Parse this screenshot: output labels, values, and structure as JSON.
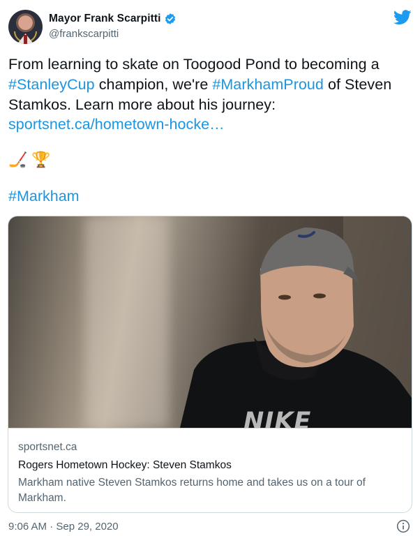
{
  "author": {
    "display_name": "Mayor Frank Scarpitti",
    "handle": "@frankscarpitti",
    "verified": true
  },
  "tweet": {
    "part1": "From learning to skate on Toogood Pond to becoming a ",
    "hashtag1": "#StanleyCup",
    "part2": " champion, we're ",
    "hashtag2": "#MarkhamProud",
    "part3": " of Steven Stamkos. Learn more about his journey: ",
    "link": "sportsnet.ca/hometown-hocke…",
    "emoji1": "🏒",
    "emoji2": "🏆",
    "hashtag3": "#Markham"
  },
  "card": {
    "domain": "sportsnet.ca",
    "title": "Rogers Hometown Hockey: Steven Stamkos",
    "description": "Markham native Steven Stamkos returns home and takes us on a tour of Markham.",
    "image_text": "NIKE"
  },
  "footer": {
    "timestamp": "9:06 AM · Sep 29, 2020"
  },
  "icons": {
    "bird": "twitter-bird-icon",
    "verified": "verified-badge-icon",
    "info": "info-icon"
  },
  "colors": {
    "link": "#1b95e0",
    "text": "#0f1419",
    "secondary": "#536471",
    "verified": "#1d9bf0"
  }
}
